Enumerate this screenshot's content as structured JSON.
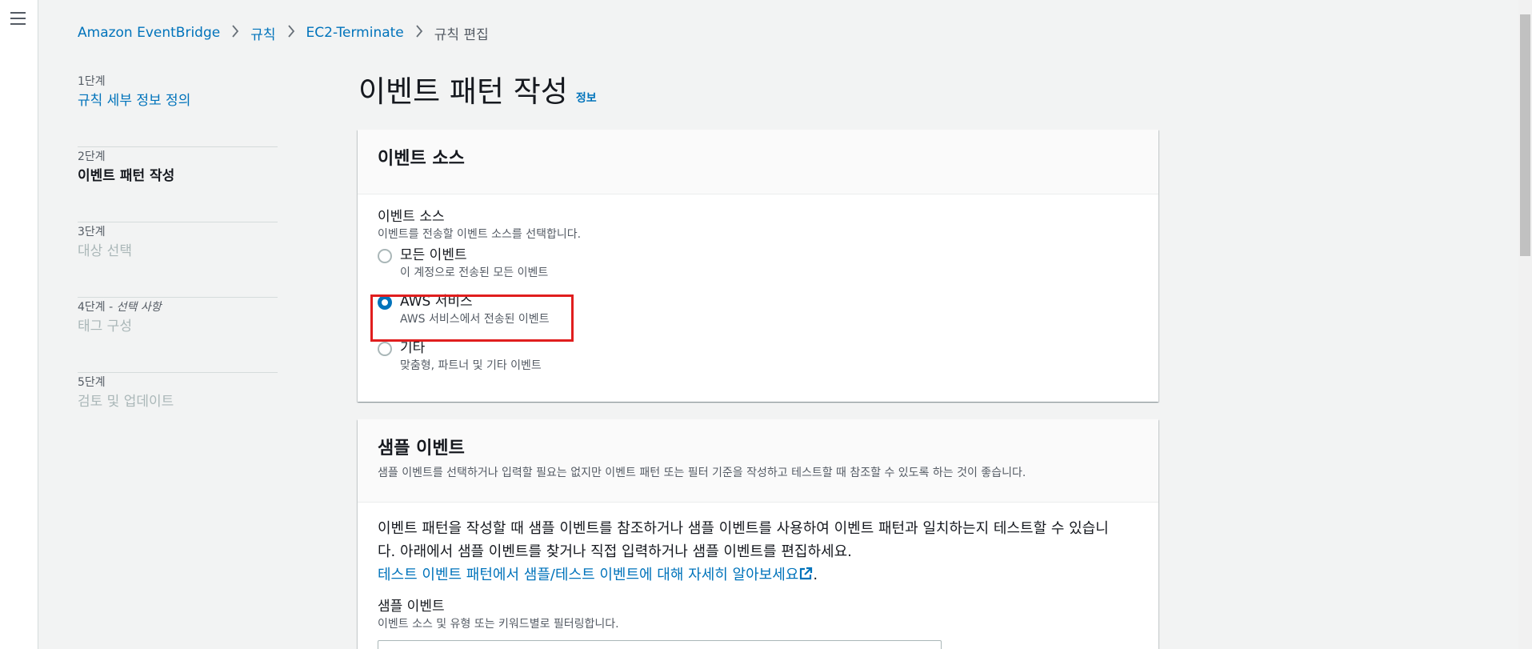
{
  "breadcrumb": {
    "items": [
      "Amazon EventBridge",
      "규칙",
      "EC2-Terminate"
    ],
    "current": "규칙 편집"
  },
  "steps": [
    {
      "num": "1단계",
      "title": "규칙 세부 정보 정의",
      "state": "link"
    },
    {
      "num": "2단계",
      "title": "이벤트 패턴 작성",
      "state": "active"
    },
    {
      "num": "3단계",
      "title": "대상 선택",
      "state": "disabled"
    },
    {
      "num": "4단계 - ",
      "num_optional": "선택 사항",
      "title": "태그 구성",
      "state": "disabled"
    },
    {
      "num": "5단계",
      "title": "검토 및 업데이트",
      "state": "disabled"
    }
  ],
  "page": {
    "title": "이벤트 패턴 작성",
    "info": "정보"
  },
  "event_source_panel": {
    "title": "이벤트 소스",
    "field_label": "이벤트 소스",
    "field_desc": "이벤트를 전송할 이벤트 소스를 선택합니다.",
    "options": [
      {
        "label": "모든 이벤트",
        "desc": "이 계정으로 전송된 모든 이벤트",
        "checked": false
      },
      {
        "label": "AWS 서비스",
        "desc": "AWS 서비스에서 전송된 이벤트",
        "checked": true
      },
      {
        "label": "기타",
        "desc": "맞춤형, 파트너 및 기타 이벤트",
        "checked": false
      }
    ]
  },
  "sample_panel": {
    "title": "샘플 이벤트",
    "desc": "샘플 이벤트를 선택하거나 입력할 필요는 없지만 이벤트 패턴 또는 필터 기준을 작성하고 테스트할 때 참조할 수 있도록 하는 것이 좋습니다.",
    "body_line1": "이벤트 패턴을 작성할 때 샘플 이벤트를 참조하거나 샘플 이벤트를 사용하여 이벤트 패턴과 일치하는지 테스트할 수 있습니",
    "body_line2": "다. 아래에서 샘플 이벤트를 찾거나 직접 입력하거나 샘플 이벤트를 편집하세요.",
    "learn_link": "테스트 이벤트 패턴에서 샘플/테스트 이벤트에 대해 자세히 알아보세요",
    "learn_suffix": ".",
    "field_label": "샘플 이벤트",
    "field_desc": "이벤트 소스 및 유형 또는 키워드별로 필터링합니다."
  },
  "colors": {
    "link": "#0073bb",
    "highlight": "#e01e1e",
    "background": "#f2f3f3"
  },
  "icons": {
    "menu": "hamburger-icon",
    "chevron": "chevron-right-icon",
    "external": "external-link-icon"
  }
}
